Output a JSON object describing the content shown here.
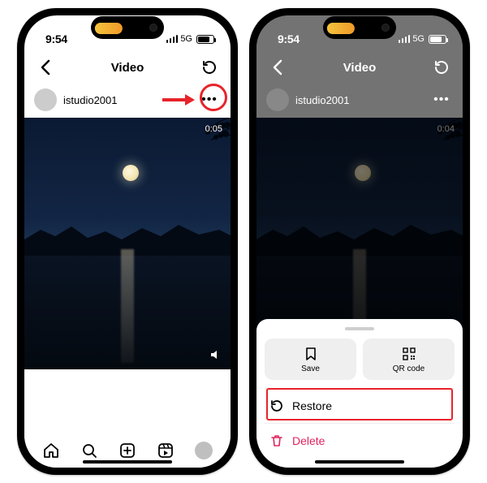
{
  "status": {
    "time": "9:54",
    "network": "5G"
  },
  "header": {
    "title": "Video"
  },
  "user": {
    "name": "istudio2001"
  },
  "video": {
    "timestamp_left": "0:05",
    "timestamp_right": "0:04"
  },
  "sheet": {
    "save": "Save",
    "qrcode": "QR code",
    "restore": "Restore",
    "delete": "Delete"
  },
  "annotation": {
    "color": "#e8232a"
  }
}
